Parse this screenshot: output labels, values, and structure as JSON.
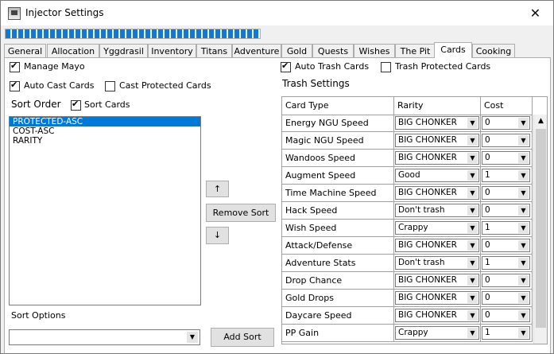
{
  "window": {
    "title": "Injector Settings",
    "close": "✕"
  },
  "progress": {
    "value": 100
  },
  "tabs": [
    {
      "label": "General"
    },
    {
      "label": "Allocation"
    },
    {
      "label": "Yggdrasil"
    },
    {
      "label": "Inventory"
    },
    {
      "label": "Titans"
    },
    {
      "label": "Adventure"
    },
    {
      "label": "Gold"
    },
    {
      "label": "Quests"
    },
    {
      "label": "Wishes"
    },
    {
      "label": "The Pit"
    },
    {
      "label": "Cards"
    },
    {
      "label": "Cooking"
    }
  ],
  "active_tab": "Cards",
  "left": {
    "manage_mayo": "Manage Mayo",
    "auto_cast_cards": "Auto Cast Cards",
    "cast_protected_cards": "Cast Protected Cards",
    "sort_order": "Sort Order",
    "sort_cards": "Sort Cards",
    "sort_list": [
      "PROTECTED-ASC",
      "COST-ASC",
      "RARITY"
    ],
    "remove_sort": "Remove Sort",
    "up": "↑",
    "down": "↓",
    "sort_options": "Sort Options",
    "add_sort": "Add Sort",
    "sort_options_value": ""
  },
  "right": {
    "auto_trash_cards": "Auto Trash Cards",
    "trash_protected_cards": "Trash Protected Cards",
    "trash_settings": "Trash Settings",
    "columns": [
      "Card Type",
      "Rarity",
      "Cost"
    ],
    "rows": [
      {
        "type": "Energy NGU Speed",
        "rarity": "BIG CHONKER",
        "cost": "0"
      },
      {
        "type": "Magic NGU Speed",
        "rarity": "BIG CHONKER",
        "cost": "0"
      },
      {
        "type": "Wandoos Speed",
        "rarity": "BIG CHONKER",
        "cost": "0"
      },
      {
        "type": "Augment Speed",
        "rarity": "Good",
        "cost": "1"
      },
      {
        "type": "Time Machine Speed",
        "rarity": "BIG CHONKER",
        "cost": "0"
      },
      {
        "type": "Hack Speed",
        "rarity": "Don't trash",
        "cost": "0"
      },
      {
        "type": "Wish Speed",
        "rarity": "Crappy",
        "cost": "1"
      },
      {
        "type": "Attack/Defense",
        "rarity": "BIG CHONKER",
        "cost": "0"
      },
      {
        "type": "Adventure Stats",
        "rarity": "Don't trash",
        "cost": "1"
      },
      {
        "type": "Drop Chance",
        "rarity": "BIG CHONKER",
        "cost": "0"
      },
      {
        "type": "Gold Drops",
        "rarity": "BIG CHONKER",
        "cost": "0"
      },
      {
        "type": "Daycare Speed",
        "rarity": "BIG CHONKER",
        "cost": "0"
      },
      {
        "type": "PP Gain",
        "rarity": "Crappy",
        "cost": "1"
      }
    ]
  }
}
